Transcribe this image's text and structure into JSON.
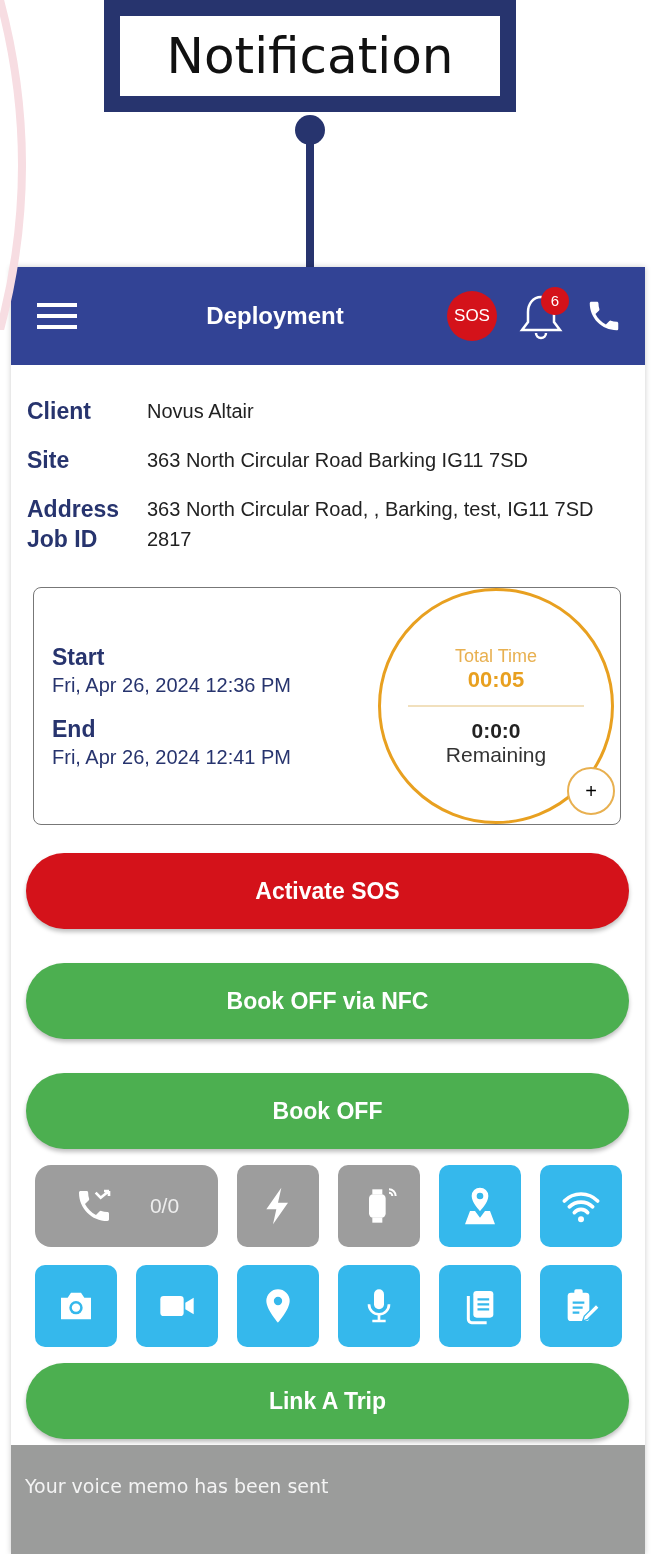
{
  "callout": {
    "label": "Notification"
  },
  "app_bar": {
    "title": "Deployment",
    "sos_badge": "SOS",
    "notification_count": "6"
  },
  "details": [
    {
      "label": "Client",
      "value": "Novus Altair"
    },
    {
      "label": "Site",
      "value": "363 North Circular Road Barking IG11 7SD"
    },
    {
      "label": "Address",
      "value": "363 North Circular Road, , Barking, test, IG11 7SD"
    },
    {
      "label": "Job ID",
      "value": "2817"
    }
  ],
  "shift": {
    "start_label": "Start",
    "start": "Fri, Apr 26, 2024 12:36 PM",
    "end_label": "End",
    "end": "Fri, Apr 26, 2024 12:41 PM",
    "total_time_label": "Total Time",
    "total_time": "00:05",
    "remaining": "0:0:0",
    "remaining_label": "Remaining",
    "add_button": "+"
  },
  "buttons": [
    {
      "label": "Activate SOS",
      "color": "#d4121a"
    },
    {
      "label": "Book OFF via NFC",
      "color": "#4caf50"
    },
    {
      "label": "Book OFF",
      "color": "#4caf50"
    }
  ],
  "tiles": [
    {
      "kind": "calls",
      "text": "0/0",
      "active": false
    },
    {
      "kind": "flash",
      "active": false
    },
    {
      "kind": "watch",
      "active": false
    },
    {
      "kind": "map",
      "active": true
    },
    {
      "kind": "wifi",
      "active": true
    },
    {
      "kind": "camera",
      "active": true
    },
    {
      "kind": "video",
      "active": true
    },
    {
      "kind": "pin",
      "active": true
    },
    {
      "kind": "mic",
      "active": true
    },
    {
      "kind": "documents",
      "active": true
    },
    {
      "kind": "clipboard",
      "active": true
    }
  ],
  "link_button": {
    "label": "Link A Trip"
  },
  "toast": {
    "message": "Your voice memo has been sent"
  }
}
